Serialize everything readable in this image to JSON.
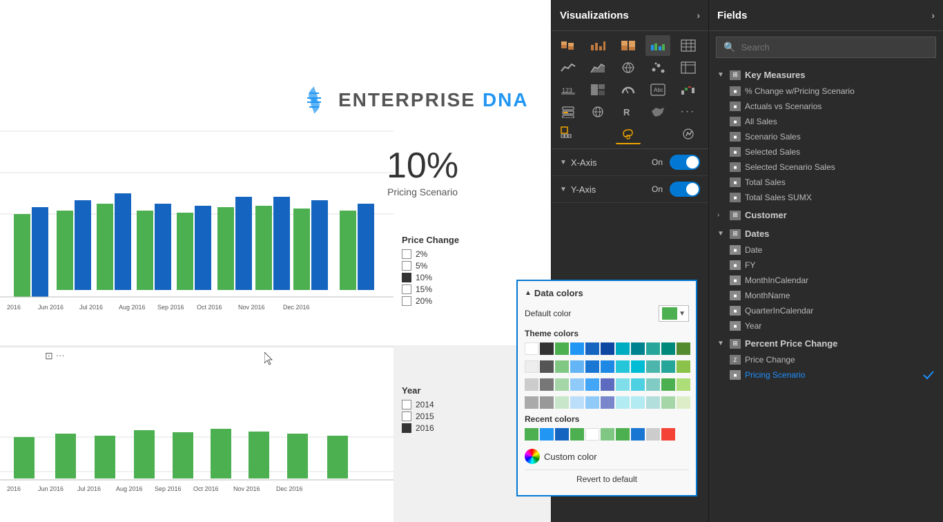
{
  "viz_panel": {
    "title": "Visualizations",
    "arrow": "›"
  },
  "fields_panel": {
    "title": "Fields",
    "arrow": "›",
    "search_placeholder": "Search"
  },
  "logo": {
    "enterprise": "ENTERPRISE",
    "dna": "DNA"
  },
  "pricing": {
    "percent": "10%",
    "label": "Pricing Scenario"
  },
  "price_change_legend": {
    "title": "Price Change",
    "items": [
      {
        "label": "2%",
        "filled": false
      },
      {
        "label": "5%",
        "filled": false
      },
      {
        "label": "10%",
        "filled": true
      },
      {
        "label": "15%",
        "filled": false
      },
      {
        "label": "20%",
        "filled": false
      }
    ]
  },
  "year_legend": {
    "title": "Year",
    "items": [
      {
        "label": "2014",
        "filled": false
      },
      {
        "label": "2015",
        "filled": false
      },
      {
        "label": "2016",
        "filled": true
      }
    ]
  },
  "xaxis": {
    "label": "X-Axis",
    "toggle": "On"
  },
  "yaxis": {
    "label": "Y-Axis",
    "toggle": "On"
  },
  "x_labels_top": [
    "2016",
    "Jun 2016",
    "Jul 2016",
    "Aug 2016",
    "Sep 2016",
    "Oct 2016",
    "Nov 2016",
    "Dec 2016"
  ],
  "x_labels_bottom": [
    "2016",
    "Jun 2016",
    "Jul 2016",
    "Aug 2016",
    "Sep 2016",
    "Oct 2016",
    "Nov 2016",
    "Dec 2016"
  ],
  "data_colors": {
    "title": "Data colors",
    "default_color_label": "Default color",
    "theme_label": "Theme colors",
    "recent_label": "Recent colors",
    "custom_label": "Custom color"
  },
  "theme_colors_row1": [
    "#fff",
    "#333",
    "#4CAF50",
    "#2196F3",
    "#1565C0",
    "#0D47A1",
    "#00ACC1",
    "#00838F",
    "#26A69A",
    "#00897B",
    "#558B2F"
  ],
  "theme_colors_row2": [
    "#eee",
    "#555",
    "#81C784",
    "#64B5F6",
    "#1976D2",
    "#1E88E5",
    "#26C6DA",
    "#00BCD4",
    "#4DB6AC",
    "#26A69A",
    "#8BC34A"
  ],
  "theme_colors_row3": [
    "#ccc",
    "#777",
    "#A5D6A7",
    "#90CAF9",
    "#42A5F5",
    "#5C6BC0",
    "#80DEEA",
    "#4DD0E1",
    "#80CBC4",
    "#4CAF50",
    "#AEDE77"
  ],
  "theme_colors_row4": [
    "#aaa",
    "#999",
    "#C8E6C9",
    "#BBDEFB",
    "#90CAF9",
    "#7986CB",
    "#B2EBF2",
    "#B2EBF2",
    "#B2DFDB",
    "#A5D6A7",
    "#DCEDC8"
  ],
  "recent_colors": [
    "#4CAF50",
    "#2196F3",
    "#1565C0",
    "#4CAF50",
    "#fff",
    "#81C784",
    "#4CAF50",
    "#1976D2",
    "#ccc",
    "#f44336"
  ],
  "fields_tree": {
    "sections": [
      {
        "label": "Key Measures",
        "expanded": true,
        "items": [
          {
            "label": "% Change w/Pricing Scenario",
            "type": "measure"
          },
          {
            "label": "Actuals vs Scenarios",
            "type": "measure"
          },
          {
            "label": "All Sales",
            "type": "measure"
          },
          {
            "label": "Scenario Sales",
            "type": "measure"
          },
          {
            "label": "Selected Sales",
            "type": "measure"
          },
          {
            "label": "Selected Scenario Sales",
            "type": "measure"
          },
          {
            "label": "Total Sales",
            "type": "measure"
          },
          {
            "label": "Total Sales SUMX",
            "type": "measure"
          }
        ]
      },
      {
        "label": "Customer",
        "expanded": false,
        "items": []
      },
      {
        "label": "Dates",
        "expanded": true,
        "items": [
          {
            "label": "Date",
            "type": "date"
          },
          {
            "label": "FY",
            "type": "field"
          },
          {
            "label": "MonthInCalendar",
            "type": "field"
          },
          {
            "label": "MonthName",
            "type": "field"
          },
          {
            "label": "QuarterInCalendar",
            "type": "field"
          },
          {
            "label": "Year",
            "type": "field"
          }
        ]
      },
      {
        "label": "Percent Price Change",
        "expanded": true,
        "items": [
          {
            "label": "Price Change",
            "type": "sigma"
          },
          {
            "label": "Pricing Scenario",
            "type": "field",
            "highlight": true
          }
        ]
      }
    ]
  }
}
